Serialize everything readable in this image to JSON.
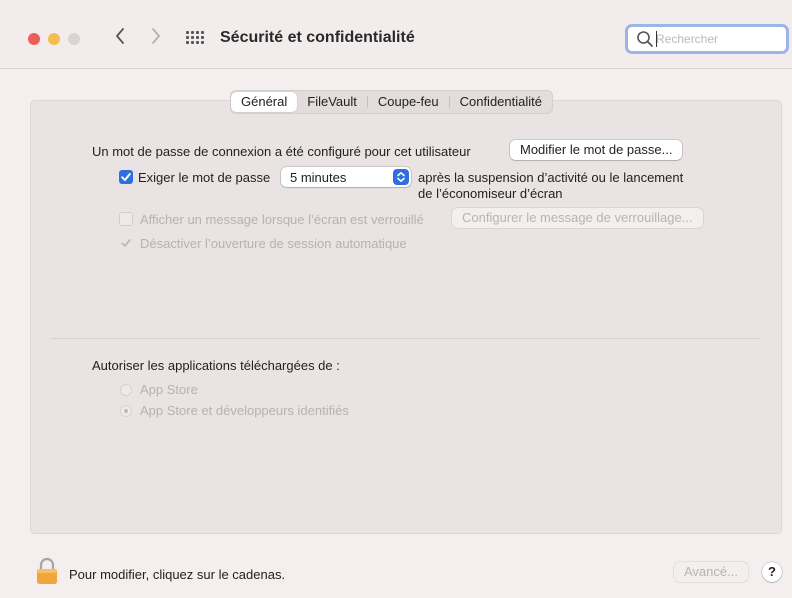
{
  "window": {
    "title": "Sécurité et confidentialité",
    "search_placeholder": "Rechercher"
  },
  "tabs": [
    {
      "label": "Général",
      "active": true
    },
    {
      "label": "FileVault",
      "active": false
    },
    {
      "label": "Coupe-feu",
      "active": false
    },
    {
      "label": "Confidentialité",
      "active": false
    }
  ],
  "general": {
    "password_set_text": "Un mot de passe de connexion a été configuré pour cet utilisateur",
    "change_password_button": "Modifier le mot de passe...",
    "require_password": {
      "label": "Exiger le mot de passe",
      "checked": true,
      "delay_value": "5 minutes",
      "after_line1": "après la suspension d’activité ou le lancement",
      "after_line2": "de l’économiseur d’écran"
    },
    "show_message": {
      "label": "Afficher un message lorsque l’écran est verrouillé",
      "checked": false,
      "enabled": false
    },
    "set_lock_message_button": "Configurer le message de verrouillage...",
    "disable_auto_login": {
      "label": "Désactiver l’ouverture de session automatique",
      "checked": true,
      "enabled": false
    },
    "allow_apps_heading": "Autoriser les applications téléchargées de :",
    "allow_apps_options": [
      {
        "label": "App Store",
        "selected": false
      },
      {
        "label": "App Store et développeurs identifiés",
        "selected": true
      }
    ]
  },
  "footer": {
    "lock_text": "Pour modifier, cliquez sur le cadenas.",
    "advanced_button": "Avancé...",
    "help_label": "?"
  },
  "colors": {
    "accent": "#2f6fe0",
    "close": "#ec5f57",
    "minimize": "#f4bd4f",
    "lock": "#f0a63a"
  }
}
